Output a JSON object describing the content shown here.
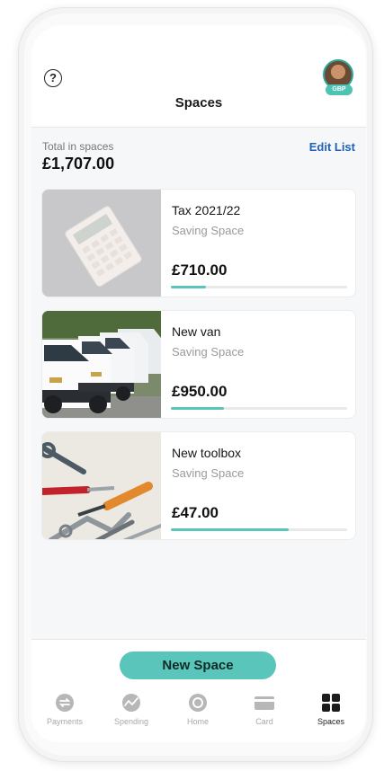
{
  "header": {
    "title": "Spaces",
    "help_glyph": "?",
    "avatar_icon": "avatar-icon",
    "currency_badge": "GBP"
  },
  "summary": {
    "total_label": "Total in spaces",
    "total_amount": "£1,707.00",
    "edit_label": "Edit List"
  },
  "spaces": [
    {
      "title": "Tax 2021/22",
      "subtitle": "Saving Space",
      "amount": "£710.00",
      "progress": 0.2,
      "image": "calculator-photo"
    },
    {
      "title": "New van",
      "subtitle": "Saving Space",
      "amount": "£950.00",
      "progress": 0.3,
      "image": "vans-photo"
    },
    {
      "title": "New toolbox",
      "subtitle": "Saving Space",
      "amount": "£47.00",
      "progress": 0.67,
      "image": "tools-photo"
    }
  ],
  "actions": {
    "new_space_label": "New Space"
  },
  "tabs": [
    {
      "label": "Payments",
      "icon": "payments-icon",
      "active": false
    },
    {
      "label": "Spending",
      "icon": "spending-icon",
      "active": false
    },
    {
      "label": "Home",
      "icon": "home-icon",
      "active": false
    },
    {
      "label": "Card",
      "icon": "card-icon",
      "active": false
    },
    {
      "label": "Spaces",
      "icon": "spaces-icon",
      "active": true
    }
  ],
  "colors": {
    "accent": "#5ac6bb",
    "link": "#1f62b8",
    "badge": "#4ec2b3"
  }
}
